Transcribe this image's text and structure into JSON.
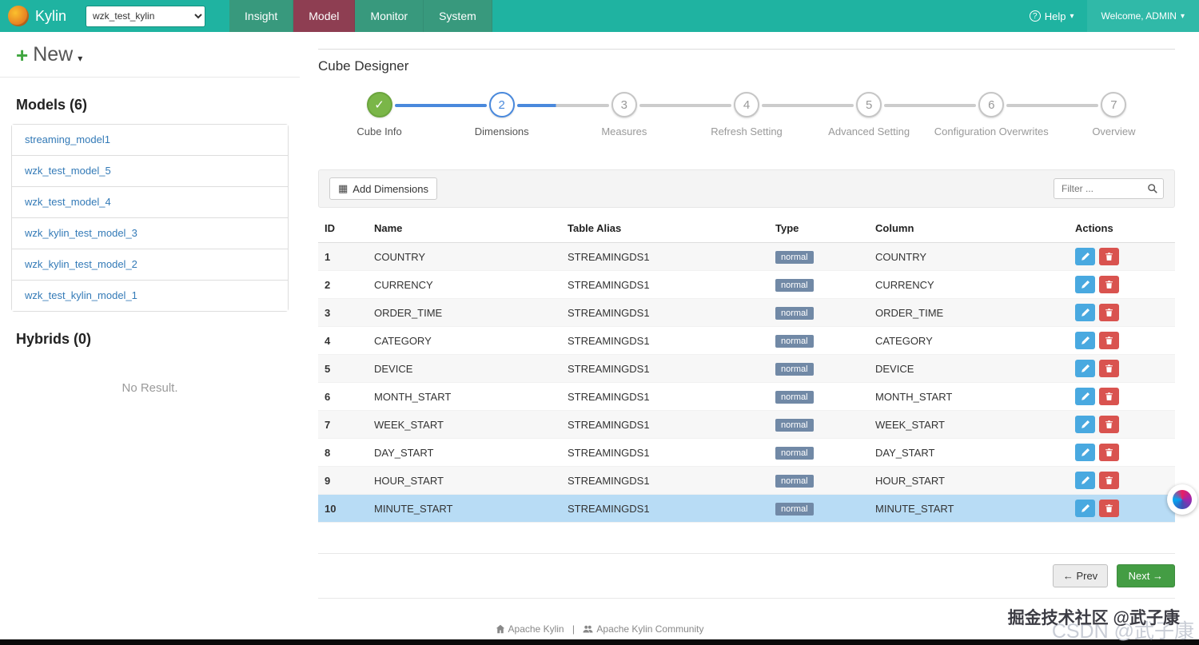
{
  "colors": {
    "navbar_bg": "#1fb3a1",
    "tab_green": "#38997d",
    "tab_model": "#8e3e52",
    "accent": "#4a89dc",
    "success": "#449d44",
    "link": "#337ab7",
    "badge": "#7189a6",
    "selected_row": "#b8dcf5",
    "edit_btn": "#49a9e0",
    "delete_btn": "#d9534f",
    "done_step": "#7ab648"
  },
  "icons": {
    "caret": "▾",
    "new_plus": "+",
    "add_grid": "▦",
    "prev_arrow": "←",
    "next_arrow": "→",
    "check": "✓",
    "help_q": "?"
  },
  "navbar": {
    "brand": "Kylin",
    "project_select": "wzk_test_kylin",
    "tabs": [
      {
        "label": "Insight",
        "active": false
      },
      {
        "label": "Model",
        "active": true
      },
      {
        "label": "Monitor",
        "active": false
      },
      {
        "label": "System",
        "active": false
      }
    ],
    "help_label": "Help",
    "welcome_label": "Welcome, ADMIN"
  },
  "sidebar": {
    "new_label": "New",
    "models_heading": "Models (6)",
    "models": [
      "streaming_model1",
      "wzk_test_model_5",
      "wzk_test_model_4",
      "wzk_kylin_test_model_3",
      "wzk_kylin_test_model_2",
      "wzk_test_kylin_model_1"
    ],
    "hybrids_heading": "Hybrids (0)",
    "no_result": "No Result."
  },
  "main": {
    "title": "Cube Designer",
    "steps": [
      {
        "num": "1",
        "label": "Cube Info",
        "state": "done",
        "line": "none"
      },
      {
        "num": "2",
        "label": "Dimensions",
        "state": "active",
        "line": "blue"
      },
      {
        "num": "3",
        "label": "Measures",
        "state": "pending",
        "line": "half"
      },
      {
        "num": "4",
        "label": "Refresh Setting",
        "state": "pending",
        "line": "gray"
      },
      {
        "num": "5",
        "label": "Advanced Setting",
        "state": "pending",
        "line": "gray"
      },
      {
        "num": "6",
        "label": "Configuration Overwrites",
        "state": "pending",
        "line": "gray"
      },
      {
        "num": "7",
        "label": "Overview",
        "state": "pending",
        "line": "gray"
      }
    ],
    "toolbar": {
      "add_button": "Add Dimensions",
      "filter_placeholder": "Filter ..."
    },
    "table": {
      "headers": [
        "ID",
        "Name",
        "Table Alias",
        "Type",
        "Column",
        "Actions"
      ],
      "rows": [
        {
          "id": "1",
          "name": "COUNTRY",
          "alias": "STREAMINGDS1",
          "type": "normal",
          "column": "COUNTRY",
          "selected": false
        },
        {
          "id": "2",
          "name": "CURRENCY",
          "alias": "STREAMINGDS1",
          "type": "normal",
          "column": "CURRENCY",
          "selected": false
        },
        {
          "id": "3",
          "name": "ORDER_TIME",
          "alias": "STREAMINGDS1",
          "type": "normal",
          "column": "ORDER_TIME",
          "selected": false
        },
        {
          "id": "4",
          "name": "CATEGORY",
          "alias": "STREAMINGDS1",
          "type": "normal",
          "column": "CATEGORY",
          "selected": false
        },
        {
          "id": "5",
          "name": "DEVICE",
          "alias": "STREAMINGDS1",
          "type": "normal",
          "column": "DEVICE",
          "selected": false
        },
        {
          "id": "6",
          "name": "MONTH_START",
          "alias": "STREAMINGDS1",
          "type": "normal",
          "column": "MONTH_START",
          "selected": false
        },
        {
          "id": "7",
          "name": "WEEK_START",
          "alias": "STREAMINGDS1",
          "type": "normal",
          "column": "WEEK_START",
          "selected": false
        },
        {
          "id": "8",
          "name": "DAY_START",
          "alias": "STREAMINGDS1",
          "type": "normal",
          "column": "DAY_START",
          "selected": false
        },
        {
          "id": "9",
          "name": "HOUR_START",
          "alias": "STREAMINGDS1",
          "type": "normal",
          "column": "HOUR_START",
          "selected": false
        },
        {
          "id": "10",
          "name": "MINUTE_START",
          "alias": "STREAMINGDS1",
          "type": "normal",
          "column": "MINUTE_START",
          "selected": true
        }
      ]
    },
    "prev_label": "Prev",
    "next_label": "Next"
  },
  "footer": {
    "link1": "Apache Kylin",
    "separator": "|",
    "link2": "Apache Kylin Community"
  },
  "watermarks": {
    "primary": "掘金技术社区 @武子康",
    "secondary": "CSDN @武子康"
  }
}
